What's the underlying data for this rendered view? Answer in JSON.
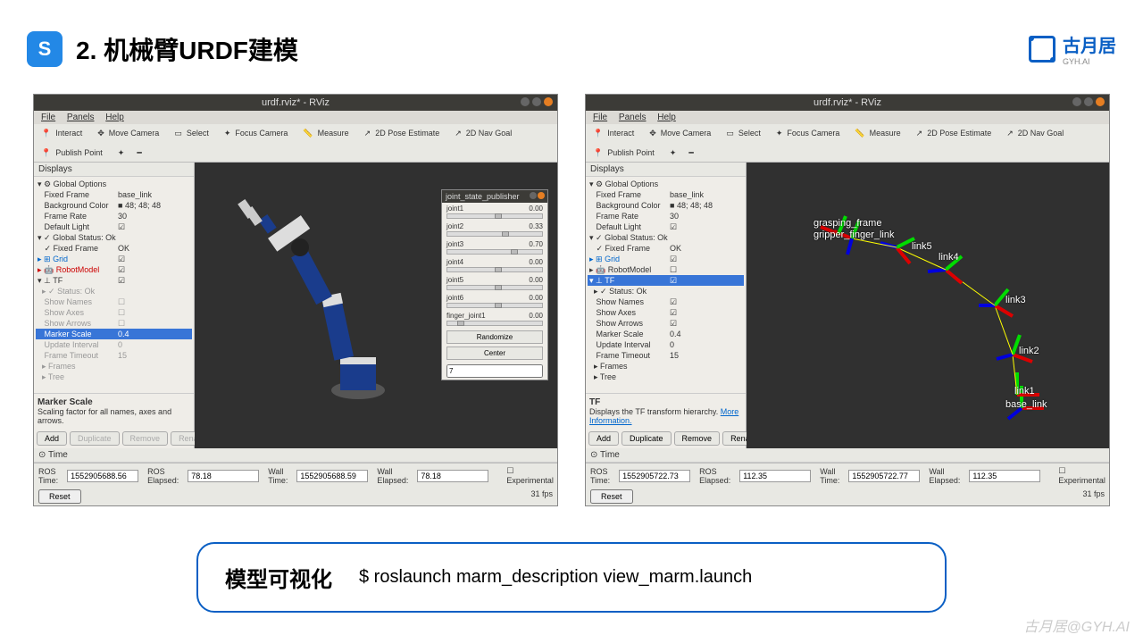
{
  "header": {
    "number": "2.",
    "title": "机械臂URDF建模",
    "icon_letter": "S"
  },
  "logo": {
    "main": "古月居",
    "sub": "GYH.AI"
  },
  "rviz": {
    "titlebar": "urdf.rviz* - RViz",
    "menu": {
      "file": "File",
      "panels": "Panels",
      "help": "Help"
    },
    "toolbar": {
      "interact": "Interact",
      "move_camera": "Move Camera",
      "select": "Select",
      "focus_camera": "Focus Camera",
      "measure": "Measure",
      "pose_estimate": "2D Pose Estimate",
      "nav_goal": "2D Nav Goal",
      "publish_point": "Publish Point"
    },
    "displays_title": "Displays",
    "tree": {
      "global_options": "Global Options",
      "fixed_frame": "Fixed Frame",
      "fixed_frame_val": "base_link",
      "bg_color": "Background Color",
      "bg_color_val": "48; 48; 48",
      "frame_rate": "Frame Rate",
      "frame_rate_val": "30",
      "default_light": "Default Light",
      "global_status": "Global Status: Ok",
      "fixed_frame2": "Fixed Frame",
      "fixed_frame2_val": "OK",
      "grid": "Grid",
      "robot_model": "RobotModel",
      "tf": "TF",
      "status_ok": "Status: Ok",
      "show_names": "Show Names",
      "show_axes": "Show Axes",
      "show_arrows": "Show Arrows",
      "marker_scale": "Marker Scale",
      "marker_scale_val": "0.4",
      "update_interval": "Update Interval",
      "update_interval_val": "0",
      "frame_timeout": "Frame Timeout",
      "frame_timeout_val": "15",
      "frames": "Frames",
      "tree_item": "Tree"
    },
    "desc1": {
      "title": "Marker Scale",
      "text": "Scaling factor for all names, axes and arrows."
    },
    "desc2": {
      "title": "TF",
      "text": "Displays the TF transform hierarchy. ",
      "link": "More Information."
    },
    "buttons": {
      "add": "Add",
      "duplicate": "Duplicate",
      "remove": "Remove",
      "rename": "Rename"
    },
    "time_label": "Time",
    "time": {
      "ros_time": "ROS Time:",
      "ros_elapsed": "ROS Elapsed:",
      "wall_time": "Wall Time:",
      "wall_elapsed": "Wall Elapsed:",
      "experimental": "Experimental",
      "reset": "Reset",
      "fps": "31 fps"
    },
    "time1": {
      "ros_time": "1552905688.56",
      "ros_elapsed": "78.18",
      "wall_time": "1552905688.59",
      "wall_elapsed": "78.18"
    },
    "time2": {
      "ros_time": "1552905722.73",
      "ros_elapsed": "112.35",
      "wall_time": "1552905722.77",
      "wall_elapsed": "112.35"
    }
  },
  "joint_panel": {
    "title": "joint_state_publisher",
    "joints": [
      {
        "name": "joint1",
        "value": "0.00",
        "pos": 50
      },
      {
        "name": "joint2",
        "value": "0.33",
        "pos": 58
      },
      {
        "name": "joint3",
        "value": "0.70",
        "pos": 67
      },
      {
        "name": "joint4",
        "value": "0.00",
        "pos": 50
      },
      {
        "name": "joint5",
        "value": "0.00",
        "pos": 50
      },
      {
        "name": "joint6",
        "value": "0.00",
        "pos": 50
      },
      {
        "name": "finger_joint1",
        "value": "0.00",
        "pos": 10
      }
    ],
    "randomize": "Randomize",
    "center": "Center",
    "input_val": "7"
  },
  "tf_labels": {
    "grasping": "grasping_frame",
    "gripper": "gripper_finger_link",
    "link5": "link5",
    "link4": "link4",
    "link3": "link3",
    "link2": "link2",
    "link1": "link1",
    "base": "base_link"
  },
  "command": {
    "label": "模型可视化",
    "text": "$ roslaunch marm_description view_marm.launch"
  },
  "watermark": "古月居@GYH.AI"
}
